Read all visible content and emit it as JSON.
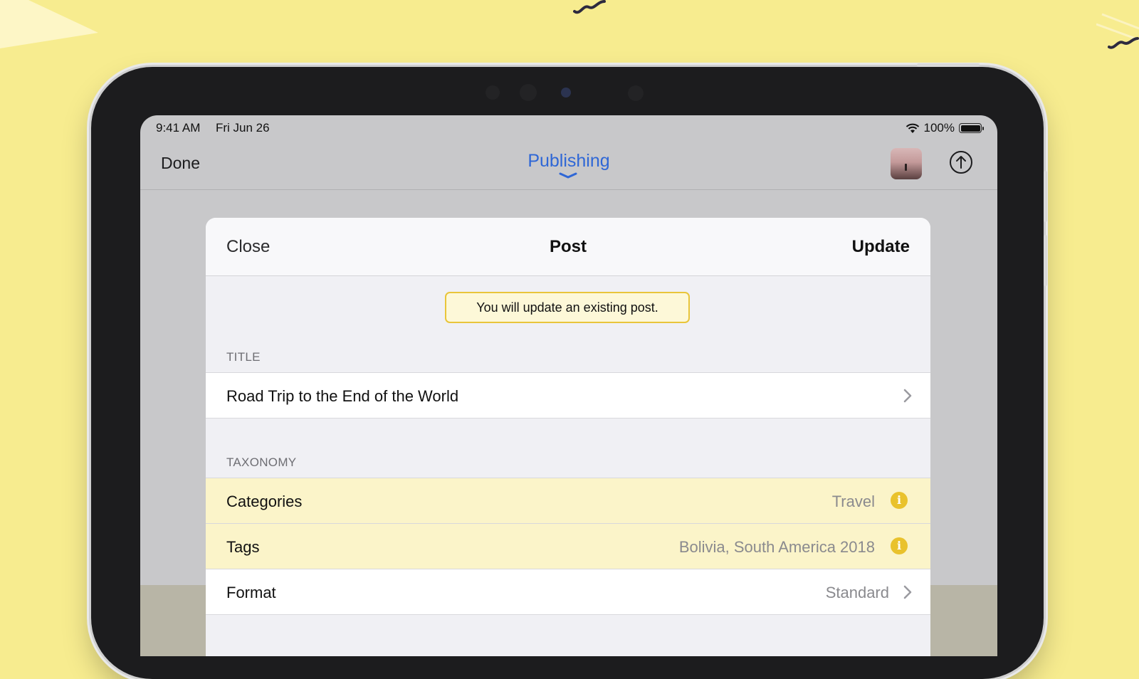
{
  "status_bar": {
    "time": "9:41 AM",
    "date": "Fri Jun 26",
    "battery": "100%",
    "wifi_icon": "wifi-icon",
    "battery_icon": "battery-icon"
  },
  "nav_bar": {
    "done_label": "Done",
    "title": "Publishing",
    "title_color": "#2f67d6",
    "thumbnail_icon": "post-thumbnail",
    "share_icon": "upload-arrow-icon"
  },
  "sheet": {
    "close_label": "Close",
    "title": "Post",
    "update_label": "Update",
    "banner_text": "You will update an existing post.",
    "banner_border_color": "#e9c53a",
    "title_section": {
      "label": "TITLE",
      "value": "Road Trip to the End of the World"
    },
    "taxonomy_section": {
      "label": "TAXONOMY",
      "rows": [
        {
          "label": "Categories",
          "value": "Travel",
          "icon": "info-icon"
        },
        {
          "label": "Tags",
          "value": "Bolivia, South America 2018",
          "icon": "info-icon"
        },
        {
          "label": "Format",
          "value": "Standard",
          "icon": "chevron-right-icon"
        }
      ]
    },
    "warning_color": "#e9c22d"
  }
}
